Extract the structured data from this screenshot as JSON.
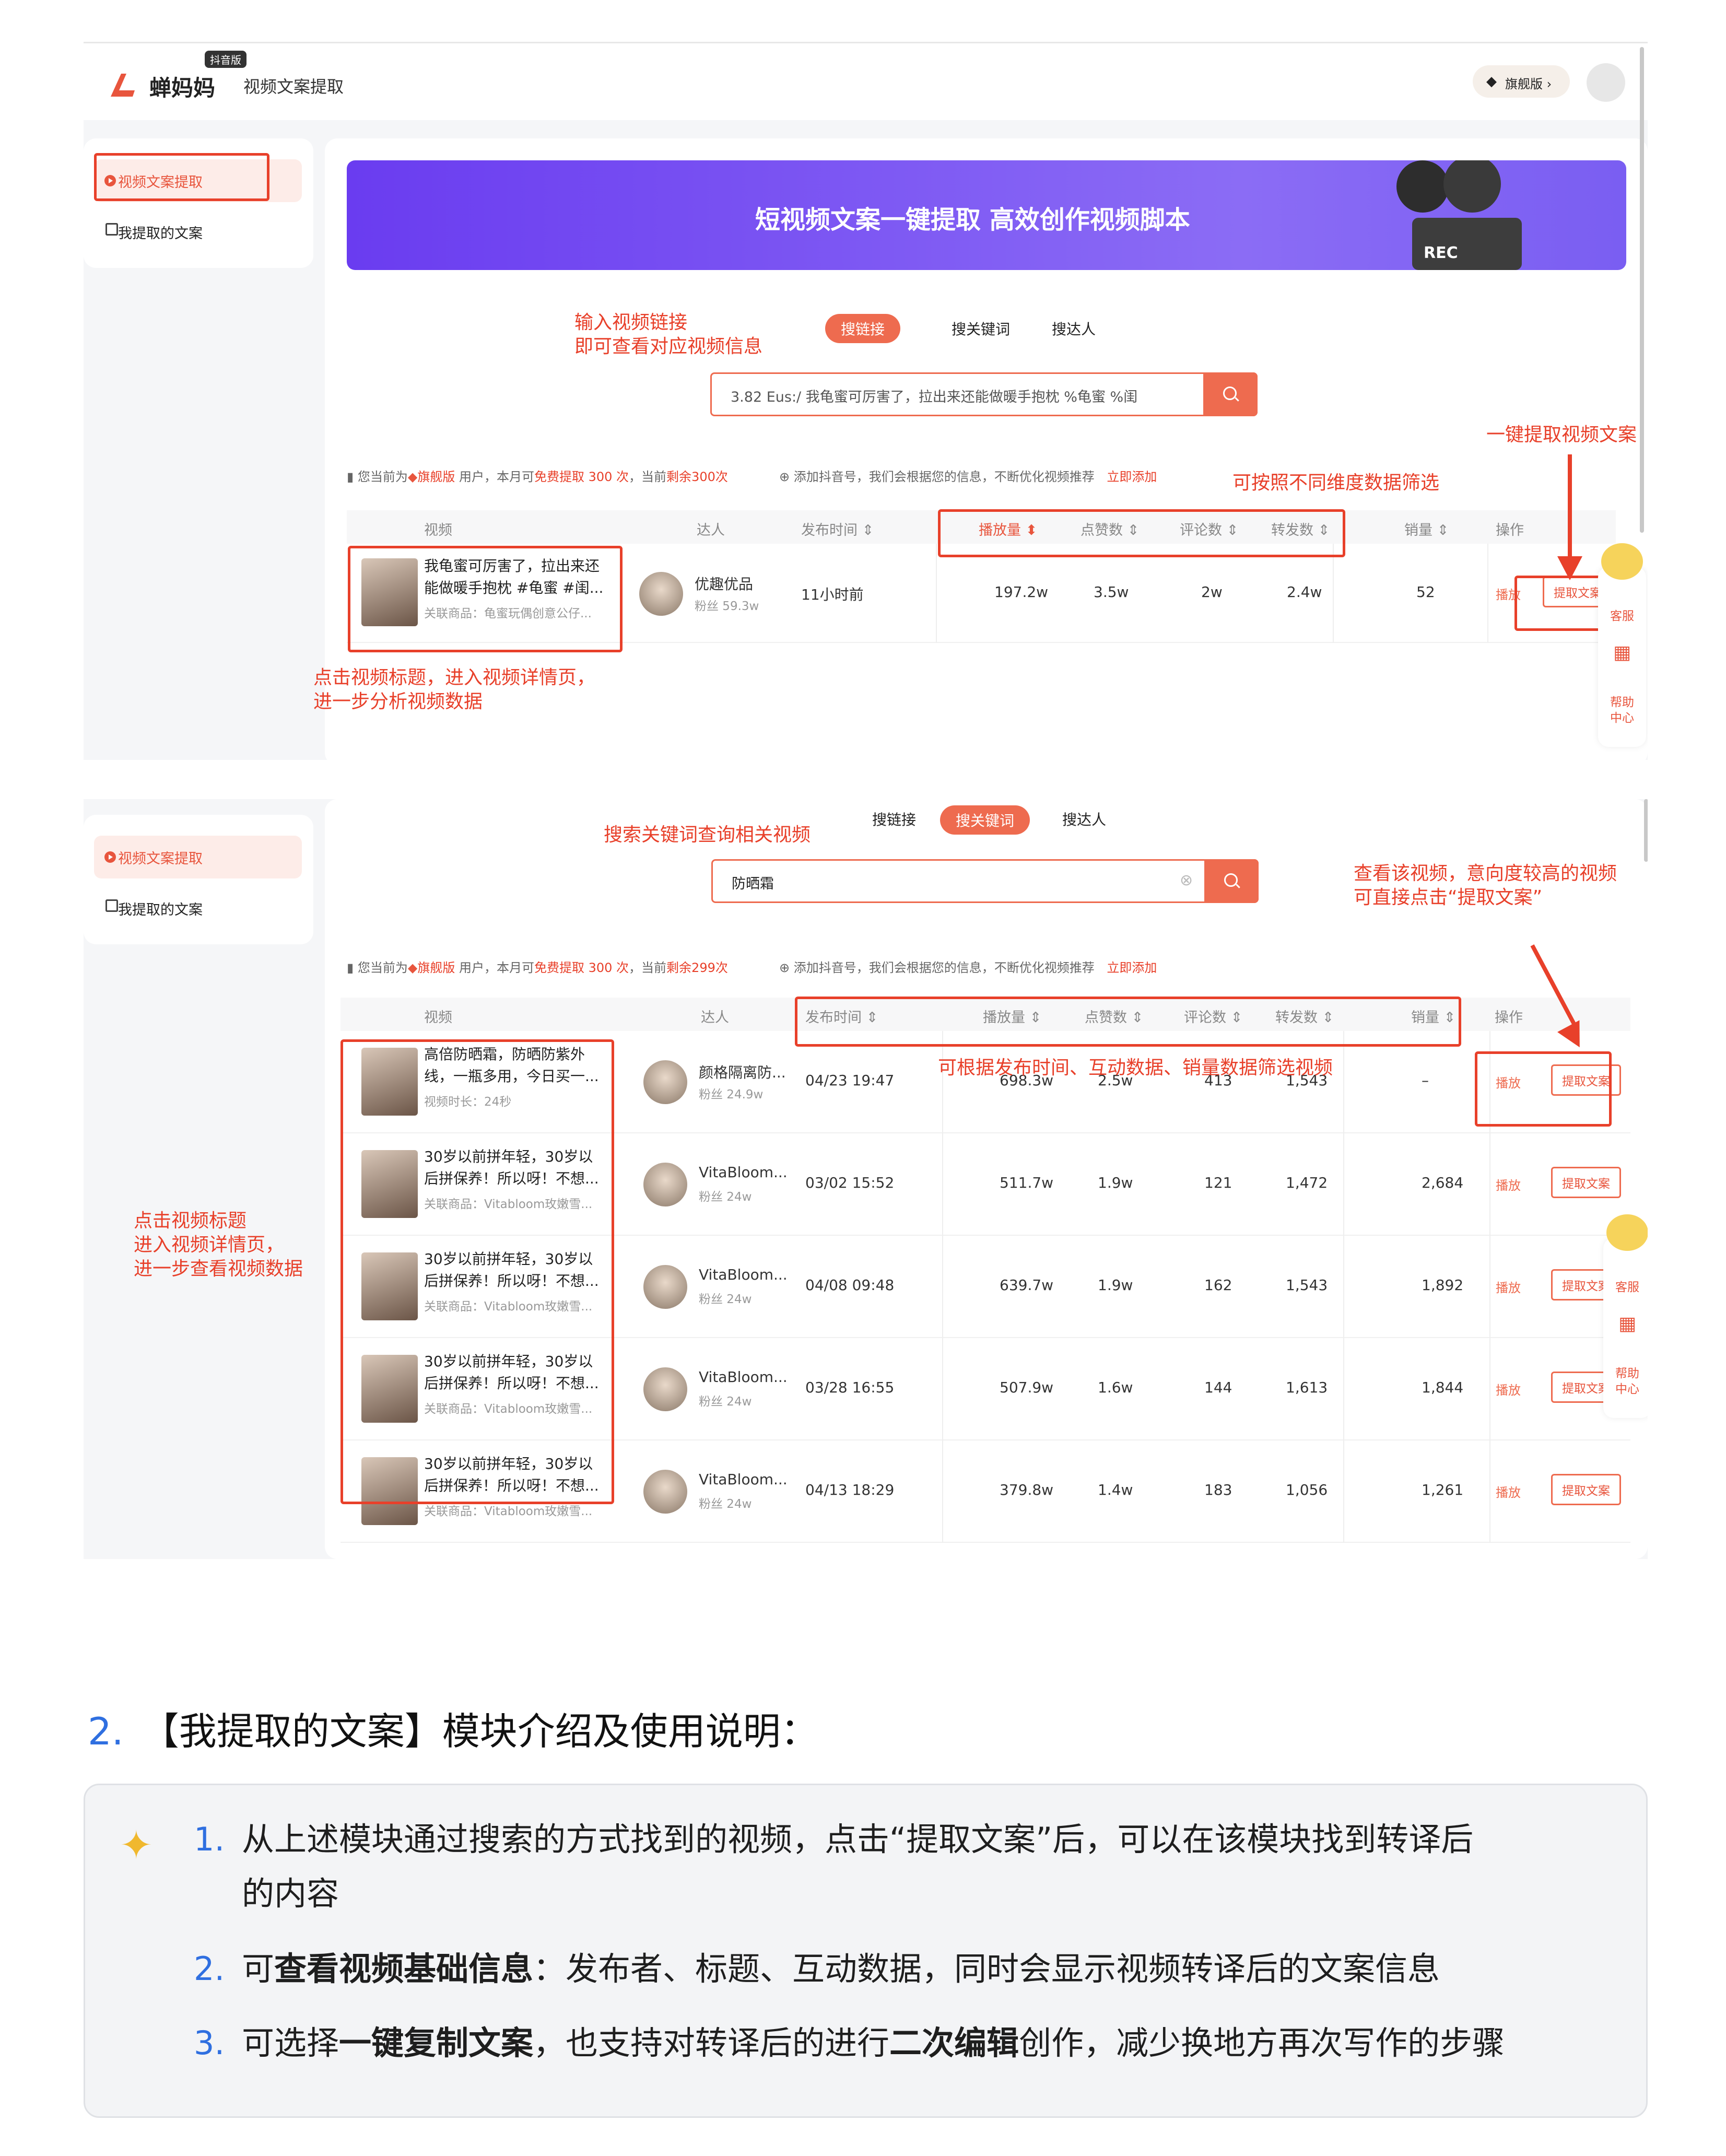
{
  "app": {
    "logo": "蝉妈妈",
    "logo_badge": "抖音版",
    "module": "视频文案提取",
    "vip": "旗舰版 ›"
  },
  "sidebar": {
    "items": [
      {
        "label": "视频文案提取",
        "active": true
      },
      {
        "label": "我提取的文案",
        "active": false
      }
    ]
  },
  "banner": {
    "title": "短视频文案一键提取 高效创作视频脚本",
    "rec": "REC"
  },
  "tabs": [
    "搜链接",
    "搜关键词",
    "搜达人"
  ],
  "shot1": {
    "search_value": "3.82 Eus:/ 我龟蜜可厉害了，拉出来还能做暖手抱枕 %龟蜜 %闺",
    "notice_a": "您当前为",
    "notice_b": "旗舰版",
    "notice_c": "用户，本月可",
    "notice_d": "免费提取 300 次",
    "notice_e": "，当前",
    "notice_f": "剩余300次",
    "notice_add": "添加抖音号，我们会根据您的信息，不断优化视频推荐",
    "notice_add_link": "立即添加",
    "headers": [
      "视频",
      "达人",
      "发布时间 ⇕",
      "播放量 ⬍",
      "点赞数 ⇕",
      "评论数 ⇕",
      "转发数 ⇕",
      "销量 ⇕",
      "操作"
    ],
    "row": {
      "title1": "我龟蜜可厉害了，拉出来还",
      "title2": "能做暖手抱枕 #龟蜜 #闺...",
      "goods": "关联商品：龟蜜玩偶创意公仔...",
      "creator": "优趣优品",
      "fans": "粉丝 59.3w",
      "time": "11小时前",
      "plays": "197.2w",
      "likes": "3.5w",
      "comments": "2w",
      "shares": "2.4w",
      "sales": "52",
      "play": "播放",
      "extract": "提取文案"
    },
    "ann_input1": "输入视频链接",
    "ann_input2": "即可查看对应视频信息",
    "ann_extract": "一键提取视频文案",
    "ann_filter": "可按照不同维度数据筛选",
    "ann_click1": "点击视频标题，进入视频详情页，",
    "ann_click2": "进一步分析视频数据"
  },
  "shot2": {
    "search_value": "防晒霜",
    "notice_a": "您当前为",
    "notice_b": "旗舰版",
    "notice_c": "用户，本月可",
    "notice_d": "免费提取 300 次",
    "notice_e": "，当前",
    "notice_f": "剩余299次",
    "notice_add": "添加抖音号，我们会根据您的信息，不断优化视频推荐",
    "notice_add_link": "立即添加",
    "headers": [
      "视频",
      "达人",
      "发布时间 ⇕",
      "播放量 ⇕",
      "点赞数 ⇕",
      "评论数 ⇕",
      "转发数 ⇕",
      "销量 ⇕",
      "操作"
    ],
    "rows": [
      {
        "title1": "高倍防晒霜，防晒防紫外",
        "title2": "线，一瓶多用，今日买一...",
        "goods": "视频时长：24秒",
        "creator": "颜格隔离防...",
        "fans": "粉丝 24.9w",
        "time": "04/23 19:47",
        "plays": "698.3w",
        "likes": "2.5w",
        "comments": "413",
        "shares": "1,543",
        "sales": "–"
      },
      {
        "title1": "30岁以前拼年轻，30岁以",
        "title2": "后拼保养！所以呀！不想...",
        "goods": "关联商品：Vitabloom玫嫩雪...",
        "creator": "VitaBloom...",
        "fans": "粉丝 24w",
        "time": "03/02 15:52",
        "plays": "511.7w",
        "likes": "1.9w",
        "comments": "121",
        "shares": "1,472",
        "sales": "2,684"
      },
      {
        "title1": "30岁以前拼年轻，30岁以",
        "title2": "后拼保养！所以呀！不想...",
        "goods": "关联商品：Vitabloom玫嫩雪...",
        "creator": "VitaBloom...",
        "fans": "粉丝 24w",
        "time": "04/08 09:48",
        "plays": "639.7w",
        "likes": "1.9w",
        "comments": "162",
        "shares": "1,543",
        "sales": "1,892"
      },
      {
        "title1": "30岁以前拼年轻，30岁以",
        "title2": "后拼保养！所以呀！不想...",
        "goods": "关联商品：Vitabloom玫嫩雪...",
        "creator": "VitaBloom...",
        "fans": "粉丝 24w",
        "time": "03/28 16:55",
        "plays": "507.9w",
        "likes": "1.6w",
        "comments": "144",
        "shares": "1,613",
        "sales": "1,844"
      },
      {
        "title1": "30岁以前拼年轻，30岁以",
        "title2": "后拼保养！所以呀！不想...",
        "goods": "关联商品：Vitabloom玫嫩雪...",
        "creator": "VitaBloom...",
        "fans": "粉丝 24w",
        "time": "04/13 18:29",
        "plays": "379.8w",
        "likes": "1.4w",
        "comments": "183",
        "shares": "1,056",
        "sales": "1,261"
      }
    ],
    "play": "播放",
    "extract": "提取文案",
    "ann_search": "搜索关键词查询相关视频",
    "ann_view1": "查看该视频，意向度较高的视频",
    "ann_view2": "可直接点击“提取文案”",
    "ann_filter": "可根据发布时间、互动数据、销量数据筛选视频",
    "ann_click1": "点击视频标题",
    "ann_click2": "进入视频详情页，",
    "ann_click3": "进一步查看视频数据"
  },
  "float": {
    "service": "客服",
    "help1": "帮助",
    "help2": "中心"
  },
  "section": {
    "num": "2.",
    "title": "【我提取的文案】模块介绍及使用说明："
  },
  "list": [
    {
      "num": "1.",
      "text1": "从上述模块通过搜索的方式找到的视频，点击“提取文案”后，可以在该模块找到转译后",
      "text2": "的内容"
    },
    {
      "num": "2.",
      "pre": "可",
      "bold": "查看视频基础信息",
      "post": "：发布者、标题、互动数据，同时会显示视频转译后的文案信息"
    },
    {
      "num": "3.",
      "pre": "可选择",
      "bold": "一键复制文案",
      "mid": "，也支持对转译后的进行",
      "bold2": "二次编辑",
      "post": "创作，减少换地方再次写作的步骤"
    }
  ],
  "colors": {
    "accent": "#ee6b4f",
    "annotation": "#e8402a",
    "link_blue": "#2f6fe0",
    "banner_from": "#6a3cf0",
    "banner_to": "#8b6cf5"
  }
}
